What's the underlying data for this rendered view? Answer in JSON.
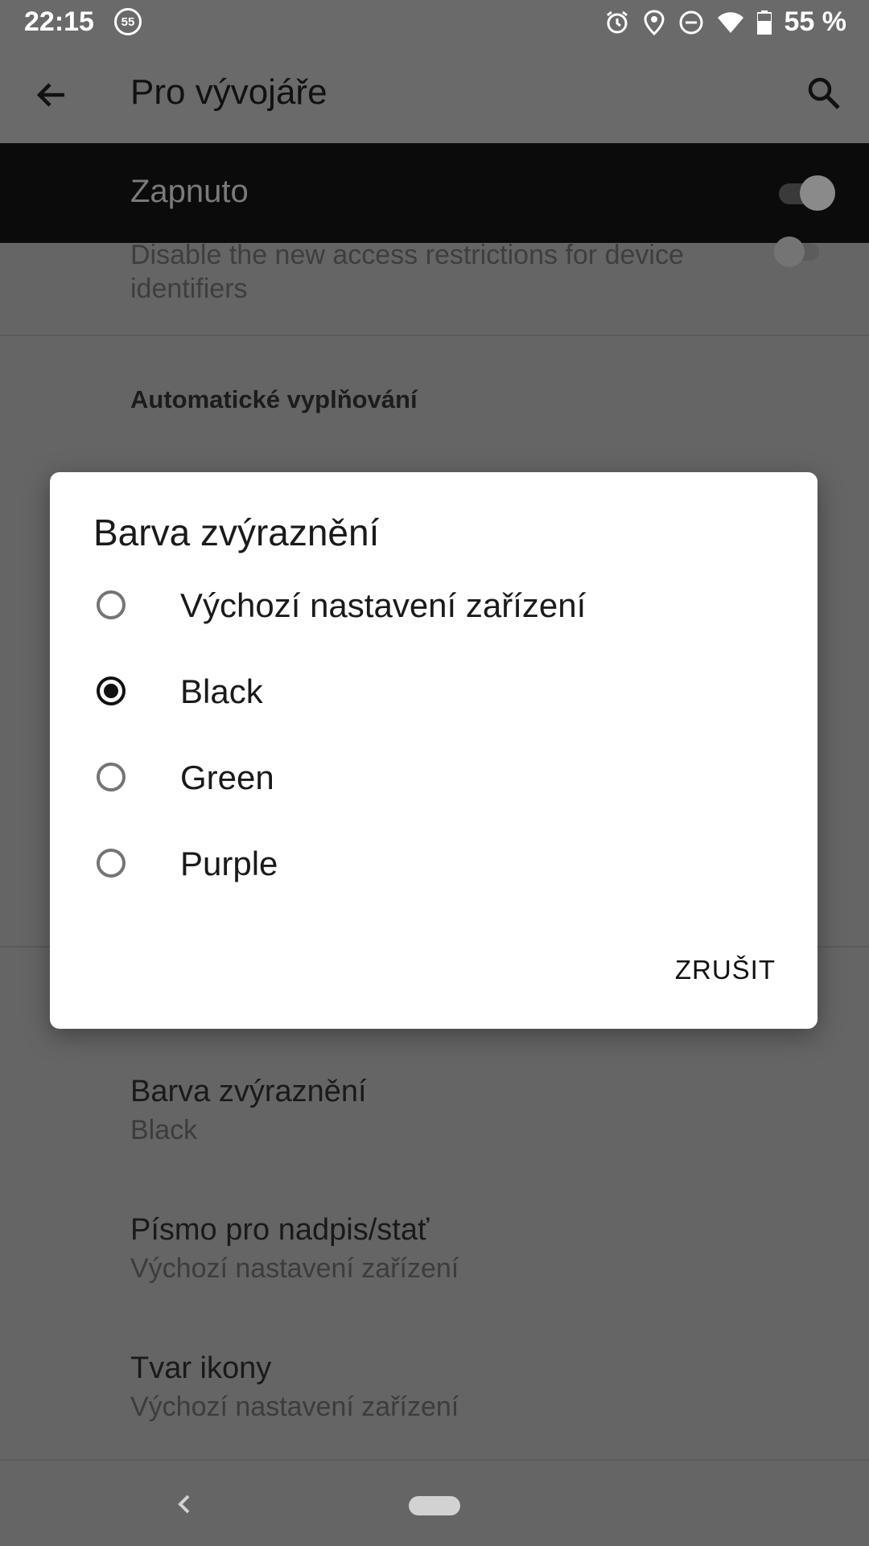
{
  "status_bar": {
    "time": "22:15",
    "notification_badge": "55",
    "battery": "55 %"
  },
  "app_bar": {
    "title": "Pro vývojáře"
  },
  "developer_options": {
    "label": "Zapnuto",
    "enabled": true
  },
  "background": {
    "restrictions_text_line1": "Disable the new access restrictions for device",
    "restrictions_text_line2": "identifiers",
    "section_header": "Automatické vyplňování",
    "accent_title": "Barva zvýraznění",
    "accent_value": "Black",
    "font_title": "Písmo pro nadpis/stať",
    "font_value": "Výchozí nastavení zařízení",
    "icon_shape_title": "Tvar ikony",
    "icon_shape_value": "Výchozí nastavení zařízení"
  },
  "dialog": {
    "title": "Barva zvýraznění",
    "options": [
      {
        "label": "Výchozí nastavení zařízení",
        "selected": false
      },
      {
        "label": "Black",
        "selected": true
      },
      {
        "label": "Green",
        "selected": false
      },
      {
        "label": "Purple",
        "selected": false
      }
    ],
    "cancel_label": "ZRUŠIT"
  },
  "colors": {
    "scrim_background": "#656565",
    "dialog_background": "#ffffff",
    "dev_row_background": "#0b0b0b"
  }
}
